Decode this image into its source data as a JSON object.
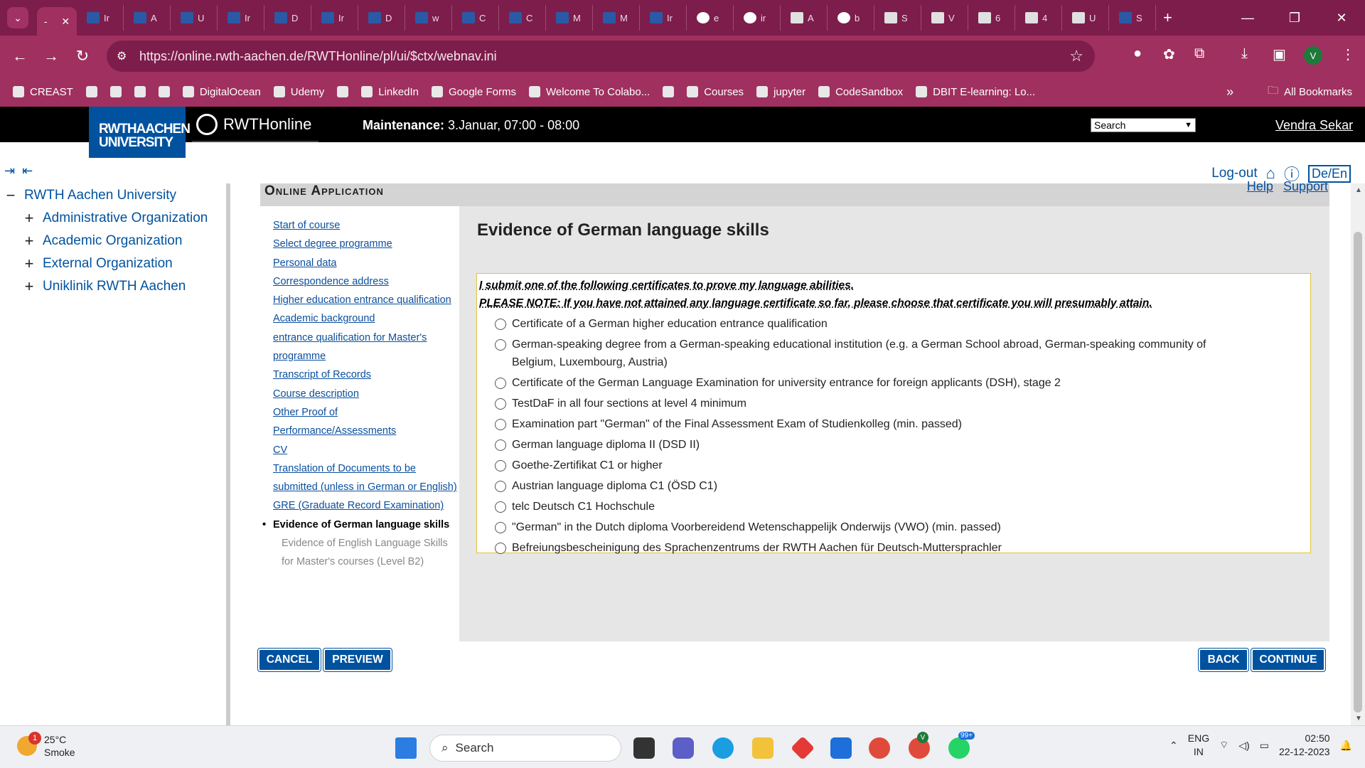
{
  "browser": {
    "active_tab": {
      "title": "-"
    },
    "tabs": [
      {
        "title": "Ir",
        "icon": "rwth-favicon"
      },
      {
        "title": "A",
        "icon": "rwth-favicon"
      },
      {
        "title": "U",
        "icon": "rwth-favicon"
      },
      {
        "title": "Ir",
        "icon": "rwth-favicon"
      },
      {
        "title": "D",
        "icon": "rwth-favicon"
      },
      {
        "title": "Ir",
        "icon": "rwth-favicon"
      },
      {
        "title": "D",
        "icon": "rwth-favicon"
      },
      {
        "title": "w",
        "icon": "globe-favicon"
      },
      {
        "title": "C",
        "icon": "rwth-favicon"
      },
      {
        "title": "C",
        "icon": "rwth-favicon"
      },
      {
        "title": "M",
        "icon": "rwth-favicon"
      },
      {
        "title": "M",
        "icon": "rwth-favicon"
      },
      {
        "title": "Ir",
        "icon": "tum-favicon"
      },
      {
        "title": "e",
        "icon": "google-favicon"
      },
      {
        "title": "ir",
        "icon": "google-favicon"
      },
      {
        "title": "A",
        "icon": "crest-favicon"
      },
      {
        "title": "b",
        "icon": "google-favicon"
      },
      {
        "title": "S",
        "icon": "crest-favicon"
      },
      {
        "title": "V",
        "icon": "crest-favicon"
      },
      {
        "title": "6",
        "icon": "crest-favicon"
      },
      {
        "title": "4",
        "icon": "crest-favicon"
      },
      {
        "title": "U",
        "icon": "doc-favicon"
      },
      {
        "title": "S",
        "icon": "gmail-favicon"
      }
    ],
    "url": "https://online.rwth-aachen.de/RWTHonline/pl/ui/$ctx/webnav.ini",
    "profile_initial": "V",
    "bookmarks": [
      {
        "label": "CREAST"
      },
      {
        "label": ""
      },
      {
        "label": ""
      },
      {
        "label": ""
      },
      {
        "label": ""
      },
      {
        "label": "DigitalOcean"
      },
      {
        "label": "Udemy"
      },
      {
        "label": ""
      },
      {
        "label": "LinkedIn"
      },
      {
        "label": "Google Forms"
      },
      {
        "label": "Welcome To Colabo..."
      },
      {
        "label": ""
      },
      {
        "label": "Courses"
      },
      {
        "label": "jupyter"
      },
      {
        "label": "CodeSandbox"
      },
      {
        "label": "DBIT E-learning: Lo..."
      }
    ],
    "bookmarks_more": "»",
    "all_bookmarks": "All Bookmarks"
  },
  "header": {
    "logo_line1": "RWTHAACHEN",
    "logo_line2": "UNIVERSITY",
    "app_name": "RWTHonline",
    "maintenance_label": "Maintenance:",
    "maintenance_value": " 3.Januar, 07:00 - 08:00",
    "search_select": "Search",
    "user_name": "Vendra Sekar"
  },
  "toolbar": {
    "logout": "Log-out",
    "lang": "De/En"
  },
  "tree": {
    "root": "RWTH Aachen University",
    "children": [
      "Administrative Organization",
      "Academic Organization",
      "External Organization",
      "Uniklinik RWTH Aachen"
    ]
  },
  "panel": {
    "title": "Online Application",
    "help": "Help",
    "support": "Support"
  },
  "steps": [
    "Start of course",
    "Select degree programme",
    "Personal data",
    "Correspondence address",
    "Higher education entrance qualification",
    "Academic background",
    "entrance qualification for Master's programme",
    "Transcript of Records",
    "Course description",
    "Other Proof of Performance/Assessments",
    "CV",
    "Translation of Documents to be submitted (unless in German or English)",
    "GRE (Graduate Record Examination)"
  ],
  "current_step": "Evidence of German language skills",
  "pending_step": "Evidence of English Language Skills for Master's courses (Level B2)",
  "content": {
    "heading": "Evidence of German language skills",
    "note1": "I submit one of the following certificates to prove my language abilities.",
    "note2": "PLEASE NOTE: If you have not attained any language certificate so far, please choose that certificate you will presumably attain.",
    "options": [
      "Certificate of a German higher education entrance qualification",
      "German-speaking degree from a German-speaking educational institution (e.g. a German School abroad, German-speaking community of Belgium, Luxembourg, Austria)",
      "Certificate of the German Language Examination for university entrance for foreign applicants (DSH), stage 2",
      "TestDaF in all four sections at level 4 minimum",
      "Examination part \"German\" of the Final Assessment Exam of Studienkolleg (min. passed)",
      "German language diploma II (DSD II)",
      "Goethe-Zertifikat C1 or higher",
      "Austrian language diploma C1 (ÖSD C1)",
      "telc Deutsch C1 Hochschule",
      "\"German\" in the Dutch diploma Voorbereidend Wetenschappelijk Onderwijs (VWO) (min. passed)",
      "Befreiungsbescheinigung des Sprachenzentrums der RWTH Aachen für Deutsch-Muttersprachler"
    ]
  },
  "buttons": {
    "cancel": "CANCEL",
    "preview": "PREVIEW",
    "back": "BACK",
    "continue": "CONTINUE"
  },
  "taskbar": {
    "weather_badge": "1",
    "temperature": "25°C",
    "condition": "Smoke",
    "search": "Search",
    "whatsapp_badge": "99+",
    "chrome_badge": "V",
    "lang_line1": "ENG",
    "lang_line2": "IN",
    "time": "02:50",
    "date": "22-12-2023"
  },
  "colors": {
    "brand_blue": "#00529f",
    "browser_frame": "#7d1d4b",
    "browser_toolbar": "#a0305f",
    "link": "#0a4f9e",
    "cert_border": "#e0c33a"
  }
}
